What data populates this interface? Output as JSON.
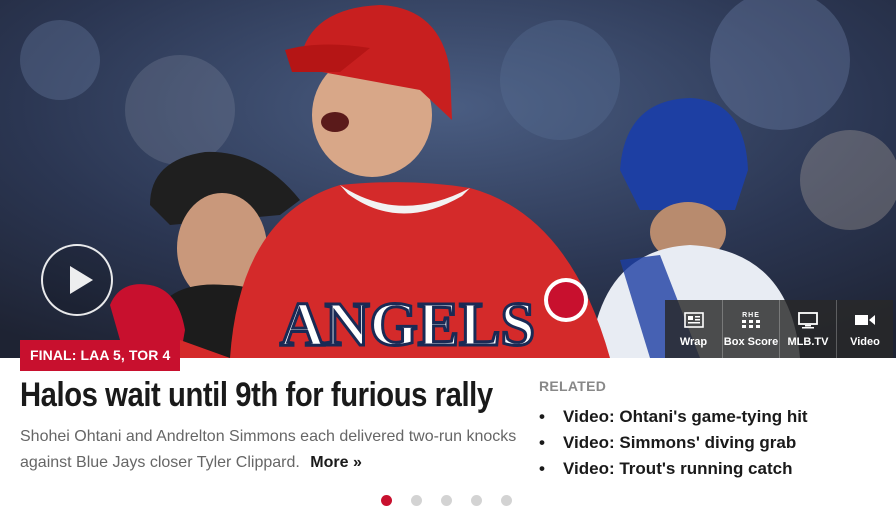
{
  "hero": {
    "player_jersey_text": "ANGELS",
    "play_button": "play-icon"
  },
  "badge": {
    "text": "FINAL: LAA 5, TOR 4"
  },
  "media_buttons": [
    {
      "label": "Wrap",
      "icon": "wrap-icon"
    },
    {
      "label": "Box Score",
      "icon": "box-score-icon",
      "icon_text": "RHE"
    },
    {
      "label": "MLB.TV",
      "icon": "tv-icon"
    },
    {
      "label": "Video",
      "icon": "video-camera-icon"
    }
  ],
  "story": {
    "headline": "Halos wait until 9th for furious rally",
    "summary": "Shohei Ohtani and Andrelton Simmons each delivered two-run knocks against Blue Jays closer Tyler Clippard.",
    "more_label": "More »"
  },
  "related": {
    "title": "RELATED",
    "items": [
      {
        "bullet": "•",
        "label": "Video: Ohtani's game-tying hit"
      },
      {
        "bullet": "•",
        "label": "Video: Simmons' diving grab"
      },
      {
        "bullet": "•",
        "label": "Video: Trout's running catch"
      }
    ]
  },
  "carousel": {
    "count": 5,
    "active_index": 0
  },
  "colors": {
    "accent": "#c8102e",
    "text": "#1a1a1a",
    "muted": "#666666"
  }
}
